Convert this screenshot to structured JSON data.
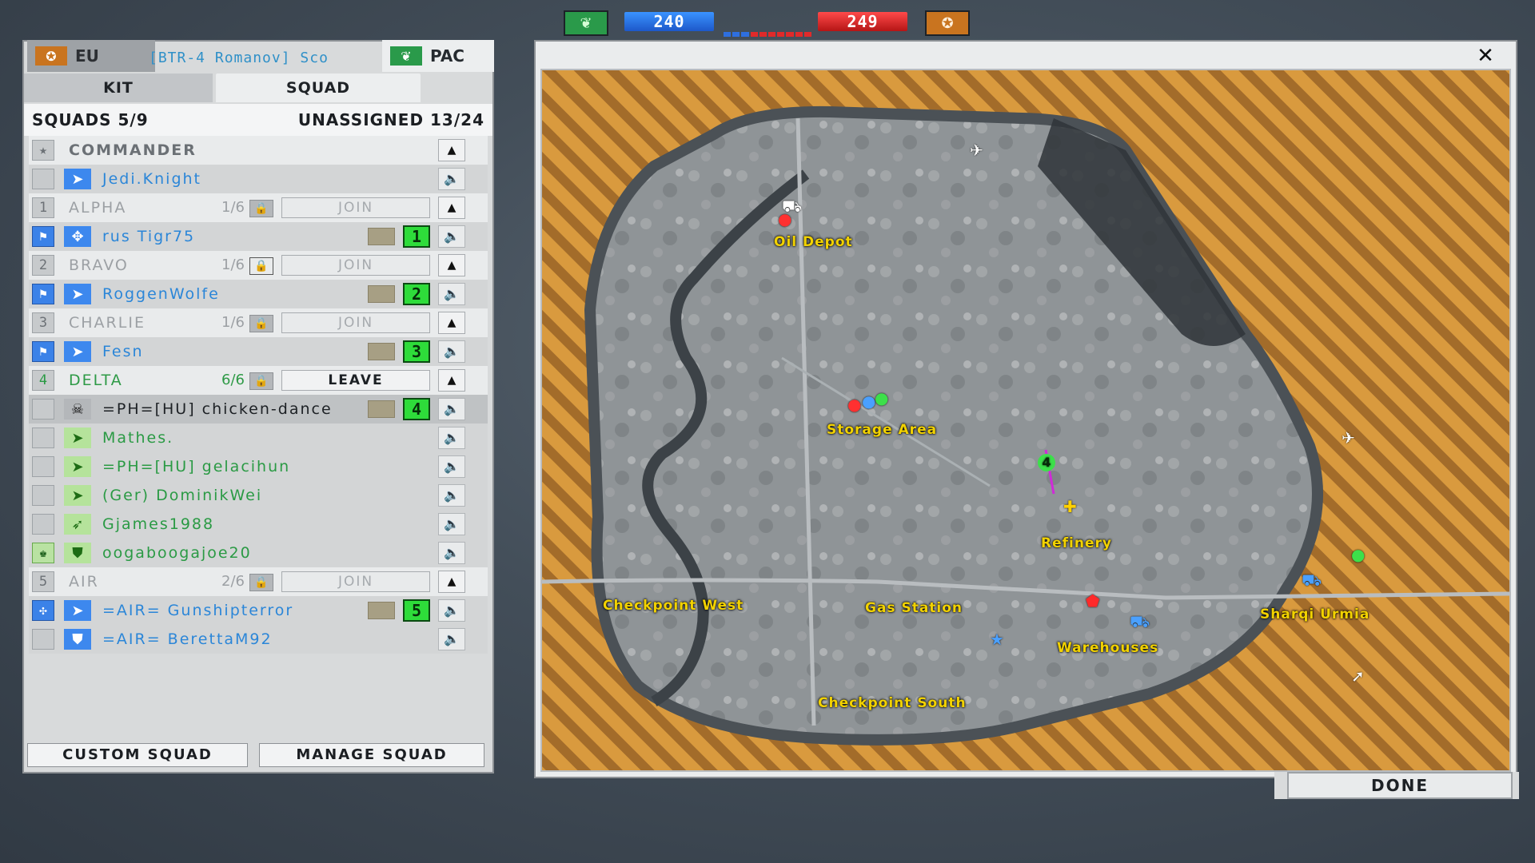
{
  "scoreboard": {
    "pac_icon": "wings-emblem-icon",
    "eu_icon": "globe-emblem-icon",
    "pac_tickets": "240",
    "eu_tickets": "249",
    "pac_color": "#2a9a4a",
    "eu_color": "#c9741f"
  },
  "team_tabs": {
    "eu_label": "EU",
    "pac_label": "PAC",
    "vehicle_tag": "[BTR-4 Romanov] Sco"
  },
  "tabs": {
    "kit": "KIT",
    "squad": "SQUAD"
  },
  "header": {
    "squads": "SQUADS 5/9",
    "unassigned": "UNASSIGNED 13/24"
  },
  "commander": {
    "label": "COMMANDER",
    "player": "Jedi.Knight"
  },
  "squads": [
    {
      "num": "1",
      "name": "ALPHA",
      "count": "1/6",
      "button": "JOIN",
      "members": [
        {
          "name": "rus Tigr75",
          "badge": "1"
        }
      ]
    },
    {
      "num": "2",
      "name": "BRAVO",
      "count": "1/6",
      "button": "JOIN",
      "members": [
        {
          "name": "RoggenWolfe",
          "badge": "2"
        }
      ]
    },
    {
      "num": "3",
      "name": "CHARLIE",
      "count": "1/6",
      "button": "JOIN",
      "members": [
        {
          "name": "Fesn",
          "badge": "3"
        }
      ]
    },
    {
      "num": "4",
      "name": "DELTA",
      "count": "6/6",
      "button": "LEAVE",
      "members": [
        {
          "name": "=PH=[HU] chicken-dance",
          "badge": "4"
        },
        {
          "name": "Mathes."
        },
        {
          "name": "=PH=[HU] gelacihun"
        },
        {
          "name": "(Ger) DominikWei"
        },
        {
          "name": "Gjames1988"
        },
        {
          "name": "oogaboogajoe20"
        }
      ]
    },
    {
      "num": "5",
      "name": "AIR",
      "count": "2/6",
      "button": "JOIN",
      "members": [
        {
          "name": "=AIR= Gunshipterror",
          "badge": "5"
        },
        {
          "name": "=AIR= BerettaM92"
        }
      ]
    }
  ],
  "panel_buttons": {
    "custom": "CUSTOM SQUAD",
    "manage": "MANAGE SQUAD"
  },
  "map": {
    "close": "✕",
    "done": "DONE",
    "locations": [
      "Oil Depot",
      "Storage Area",
      "Refinery",
      "Checkpoint West",
      "Gas Station",
      "Warehouses",
      "Sharqi Urmia",
      "Checkpoint South"
    ],
    "squad_marker": "4"
  }
}
